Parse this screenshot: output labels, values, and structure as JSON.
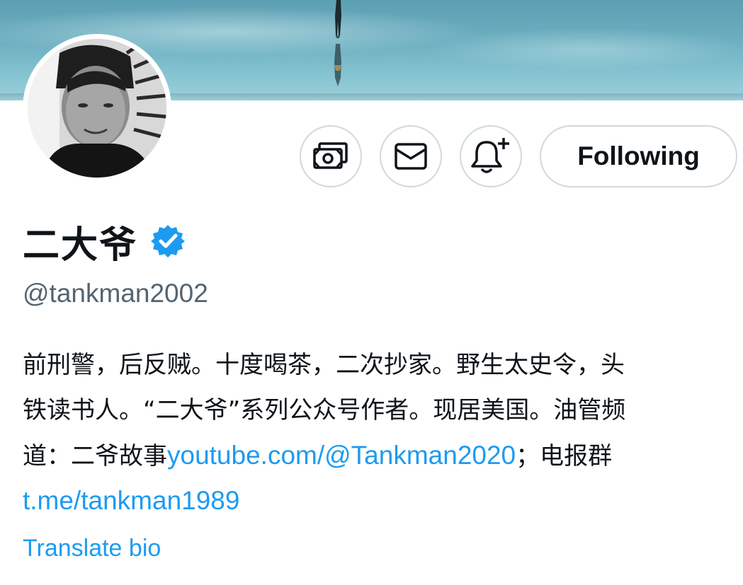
{
  "profile": {
    "display_name": "二大爷",
    "handle": "@tankman2002",
    "verified": true,
    "bio": {
      "line1": "前刑警，后反贼。十度喝茶，二次抄家。野生太史令，头",
      "line2": "铁读书人。“二大爷”系列公众号作者。现居美国。油管频",
      "line3_prefix": "道：二爷故事",
      "youtube_link": "youtube.com/@Tankman2020",
      "line3_suffix": "；电报群",
      "telegram_link": "t.me/tankman1989"
    },
    "translate_label": "Translate bio"
  },
  "actions": {
    "tip_icon": "money-icon",
    "message_icon": "envelope-icon",
    "notify_icon": "bell-plus-icon",
    "follow_label": "Following"
  },
  "colors": {
    "link": "#1d9bf0",
    "verified": "#1d9bf0",
    "muted": "#536471",
    "border": "#cfd9de"
  }
}
